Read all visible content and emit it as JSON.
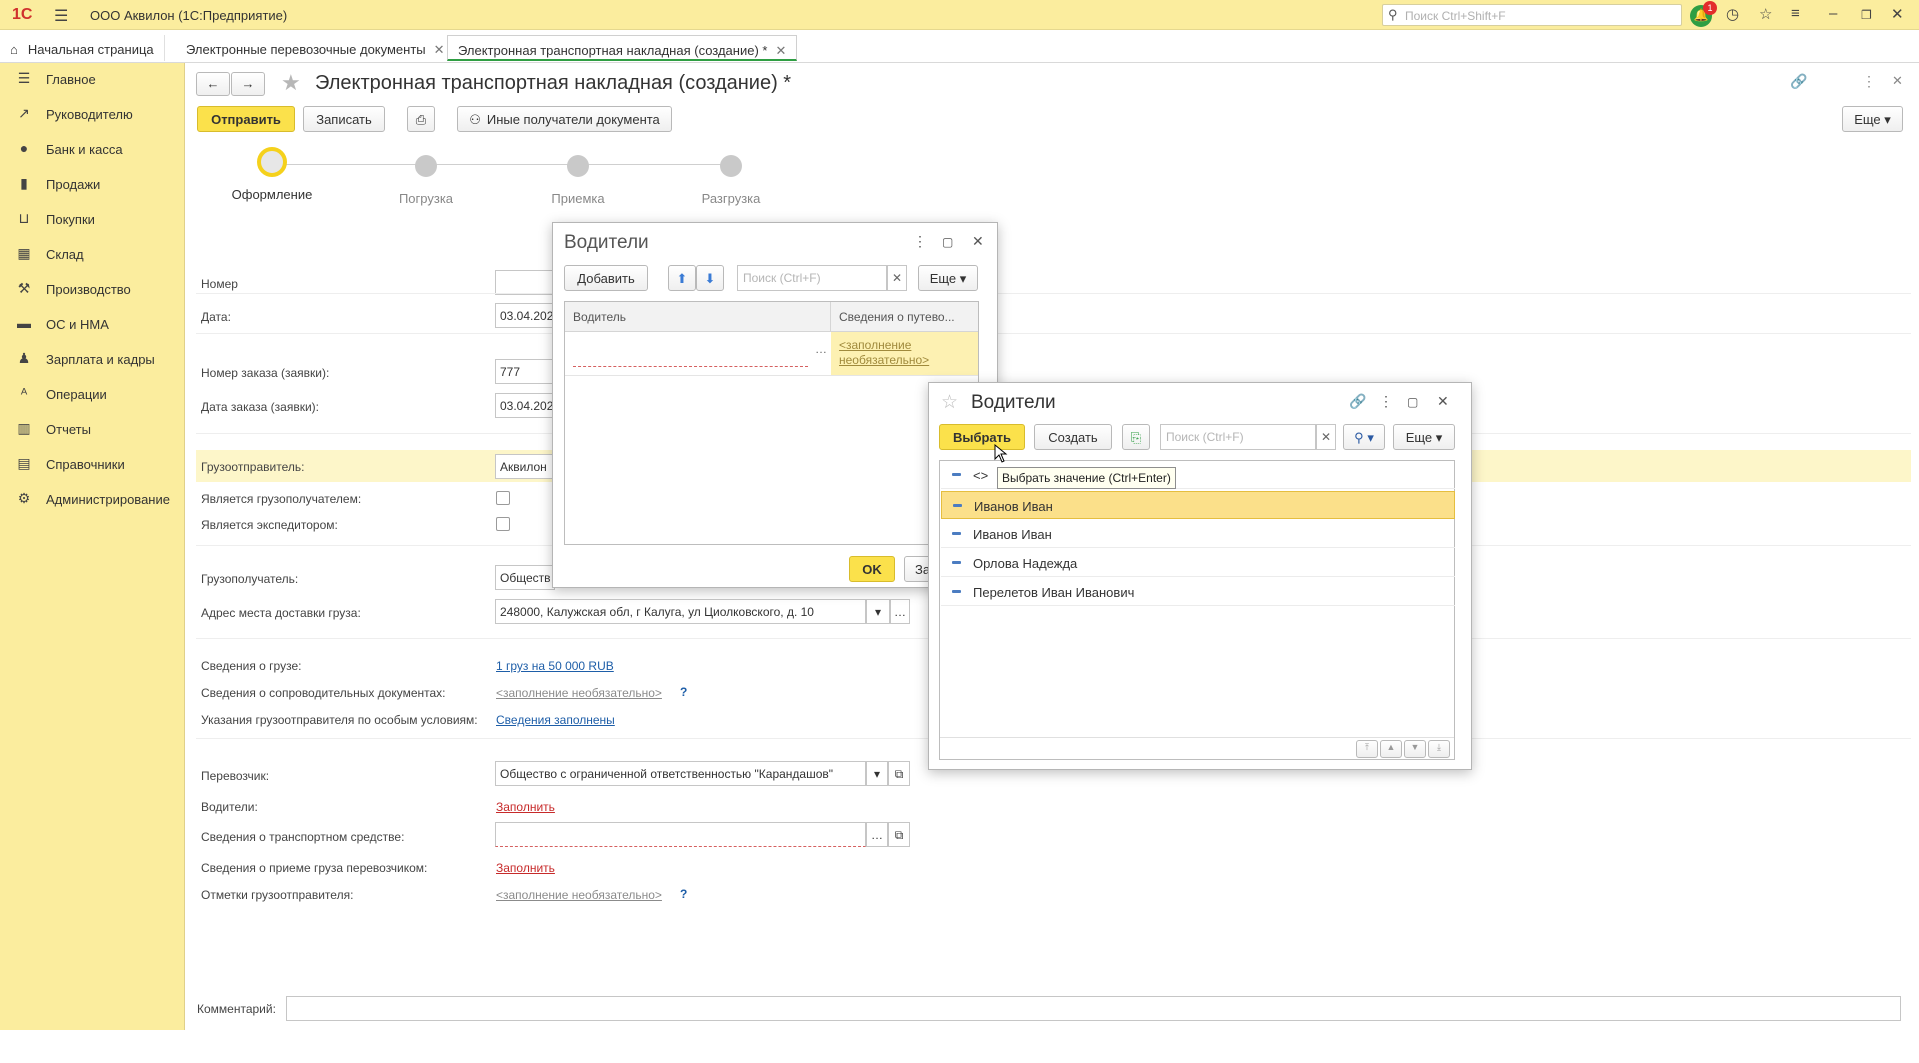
{
  "app": {
    "title": "ООО Аквилон  (1С:Предприятие)",
    "logo": "1С",
    "search_placeholder": "Поиск Ctrl+Shift+F",
    "notifications_count": "1"
  },
  "tabs": [
    {
      "label": "Начальная страница"
    },
    {
      "label": "Электронные перевозочные документы"
    },
    {
      "label": "Электронная транспортная накладная (создание) *"
    }
  ],
  "sidebar": {
    "items": [
      {
        "label": "Главное",
        "icon": "menu-icon"
      },
      {
        "label": "Руководителю",
        "icon": "chart-trend-icon"
      },
      {
        "label": "Банк и касса",
        "icon": "coin-icon"
      },
      {
        "label": "Продажи",
        "icon": "bag-icon"
      },
      {
        "label": "Покупки",
        "icon": "cart-icon"
      },
      {
        "label": "Склад",
        "icon": "warehouse-icon"
      },
      {
        "label": "Производство",
        "icon": "factory-icon"
      },
      {
        "label": "ОС и НМА",
        "icon": "truck-icon"
      },
      {
        "label": "Зарплата и кадры",
        "icon": "person-icon"
      },
      {
        "label": "Операции",
        "icon": "operations-icon"
      },
      {
        "label": "Отчеты",
        "icon": "bar-chart-icon"
      },
      {
        "label": "Справочники",
        "icon": "book-icon"
      },
      {
        "label": "Администрирование",
        "icon": "gear-icon"
      }
    ]
  },
  "form": {
    "title": "Электронная транспортная накладная (создание) *",
    "buttons": {
      "send": "Отправить",
      "save": "Записать",
      "recipients": "Иные получатели документа",
      "more": "Еще"
    },
    "steps": [
      {
        "label": "Оформление",
        "active": true
      },
      {
        "label": "Погрузка",
        "active": false
      },
      {
        "label": "Приемка",
        "active": false
      },
      {
        "label": "Разгрузка",
        "active": false
      }
    ],
    "fields": {
      "number_label": "Номер",
      "number_value": "",
      "date_label": "Дата:",
      "date_value": "03.04.202",
      "order_number_label": "Номер заказа (заявки):",
      "order_number_value": "777",
      "order_date_label": "Дата заказа (заявки):",
      "order_date_value": "03.04.202",
      "shipper_label": "Грузоотправитель:",
      "shipper_value": "Аквилон",
      "is_consignee_label": "Является грузополучателем:",
      "is_forwarder_label": "Является экспедитором:",
      "consignee_label": "Грузополучатель:",
      "consignee_value": "Обществ",
      "delivery_address_label": "Адрес места доставки груза:",
      "delivery_address_value": "248000, Калужская обл, г Калуга, ул Циолковского, д. 10",
      "cargo_label": "Сведения о грузе:",
      "cargo_value": "1 груз на 50 000 RUB",
      "docs_label": "Сведения о сопроводительных документах:",
      "docs_value": "<заполнение необязательно>",
      "special_label": "Указания грузоотправителя по особым условиям:",
      "special_value": "Сведения заполнены",
      "carrier_label": "Перевозчик:",
      "carrier_value": "Общество с ограниченной ответственностью \"Карандашов\"",
      "drivers_label": "Водители:",
      "drivers_value": "Заполнить",
      "vehicle_label": "Сведения о транспортном средстве:",
      "vehicle_value": "",
      "acceptance_label": "Сведения о приеме груза перевозчиком:",
      "acceptance_value": "Заполнить",
      "marks_label": "Отметки грузоотправителя:",
      "marks_value": "<заполнение необязательно>",
      "comment_label": "Комментарий:",
      "comment_value": "",
      "qmark": "?"
    }
  },
  "drivers_dialog": {
    "title": "Водители",
    "add_button": "Добавить",
    "search_placeholder": "Поиск (Ctrl+F)",
    "more_button": "Еще",
    "col_driver": "Водитель",
    "col_waybill": "Сведения о путево...",
    "row_waybill_value": "<заполнение необязательно>",
    "ok_button": "OK",
    "close_button_partial": "За"
  },
  "select_dialog": {
    "title": "Водители",
    "select_button": "Выбрать",
    "create_button": "Создать",
    "search_placeholder": "Поиск (Ctrl+F)",
    "more_button": "Еще",
    "empty_row": "<>",
    "tooltip": "Выбрать значение (Ctrl+Enter)",
    "rows": [
      {
        "label": "Иванов Иван",
        "selected": true
      },
      {
        "label": "Иванов Иван",
        "selected": false
      },
      {
        "label": "Орлова Надежда",
        "selected": false
      },
      {
        "label": "Перелетов Иван Иванович",
        "selected": false
      }
    ]
  }
}
